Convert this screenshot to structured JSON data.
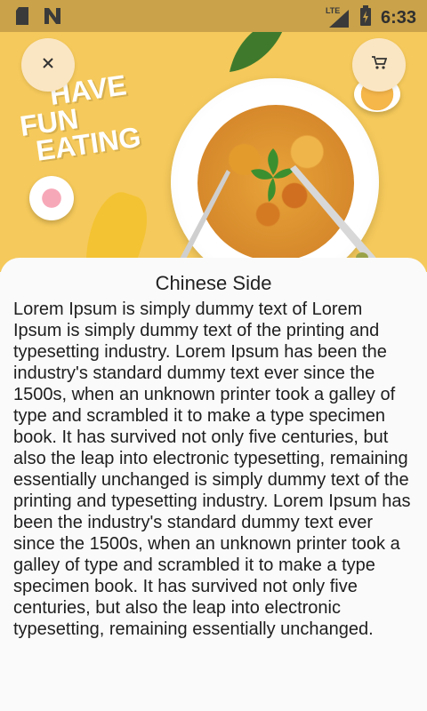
{
  "status_bar": {
    "time": "6:33",
    "network_label": "LTE",
    "icons": [
      "sd-card-icon",
      "n-app-icon",
      "signal-lte-icon",
      "battery-charging-icon"
    ]
  },
  "hero": {
    "logo_lines": [
      "HAVE",
      "FUN",
      "EATING"
    ]
  },
  "actions": {
    "close_icon": "close-icon",
    "cart_icon": "cart-icon"
  },
  "product": {
    "title": "Chinese Side",
    "description": "Lorem Ipsum is simply dummy text of Lorem Ipsum is simply dummy text of the printing and typesetting industry. Lorem Ipsum has been the industry's standard dummy text ever since the 1500s, when an unknown printer took a galley of type and scrambled it to make a type specimen book. It has survived not only five centuries, but also the leap into electronic typesetting, remaining essentially unchanged is simply dummy text of the printing and typesetting industry. Lorem Ipsum has been the industry's standard dummy text ever since the 1500s, when an unknown printer took a galley of type and scrambled it to make a type specimen book. It has survived not only five centuries, but also the leap into electronic typesetting, remaining essentially unchanged."
  },
  "colors": {
    "hero_bg": "#f5c95b",
    "status_bar_bg": "#c9a24a",
    "fab_bg": "#fbe6c3",
    "sheet_bg": "#fafafa"
  }
}
